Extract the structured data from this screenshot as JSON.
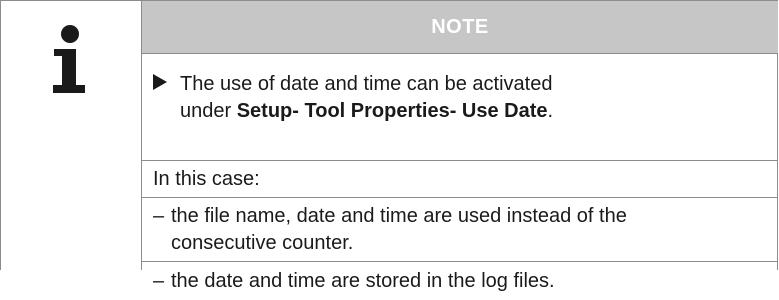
{
  "note": {
    "title": "NOTE",
    "instruction": {
      "line1": "The use of date and time can be activated",
      "line2_prefix": "under ",
      "menu_path": "Setup- Tool Properties- Use Date",
      "line2_suffix": "."
    },
    "case_intro": "In this case:",
    "items": [
      {
        "dash": "–",
        "line1": "the file name, date and time are used instead of the",
        "line2": "consecutive counter."
      },
      {
        "dash": "–",
        "line1": "the date and time are stored in the log files."
      }
    ],
    "icon": "info-icon",
    "colors": {
      "header_bg": "#c6c6c6",
      "header_text": "#ffffff",
      "border": "#8c8c8c",
      "text": "#1a1a1a"
    }
  }
}
